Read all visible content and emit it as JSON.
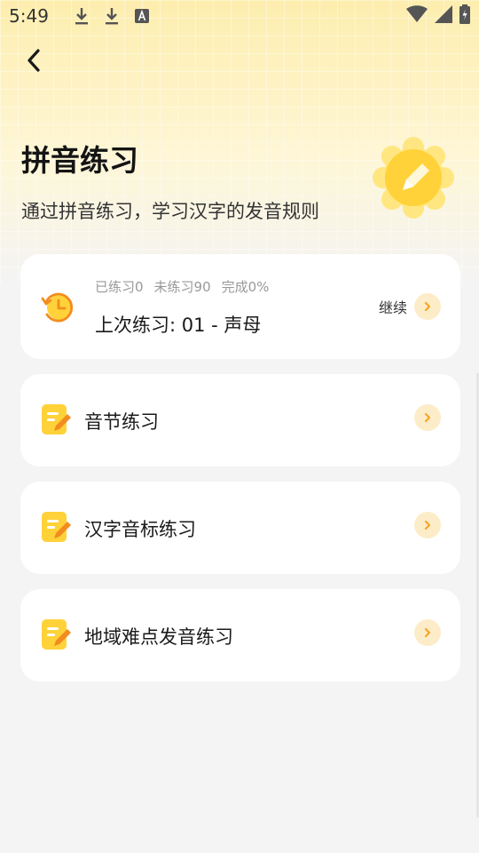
{
  "status_bar": {
    "time": "5:49",
    "icons": [
      "download-icon",
      "download-icon",
      "accessibility-a-icon",
      "wifi-icon",
      "signal-icon",
      "battery-charging-icon"
    ]
  },
  "header": {
    "back_icon": "chevron-left-icon",
    "title": "拼音练习",
    "subtitle": "通过拼音练习，学习汉字的发音规则",
    "badge_icon": "pencil-badge-icon"
  },
  "progress_card": {
    "icon": "history-icon",
    "practiced": "已练习0",
    "unpracticed": "未练习90",
    "completed": "完成0%",
    "last_practice": "上次练习: 01 - 声母",
    "continue_label": "继续"
  },
  "menu": {
    "items": [
      {
        "label": "音节练习",
        "icon": "note-edit-icon"
      },
      {
        "label": "汉字音标练习",
        "icon": "note-edit-icon"
      },
      {
        "label": "地域难点发音练习",
        "icon": "note-edit-icon"
      }
    ]
  },
  "colors": {
    "accent_yellow": "#ffd23a",
    "accent_orange": "#f5a623",
    "arrow_bg": "#fdecc8",
    "background": "#f4f4f4"
  }
}
